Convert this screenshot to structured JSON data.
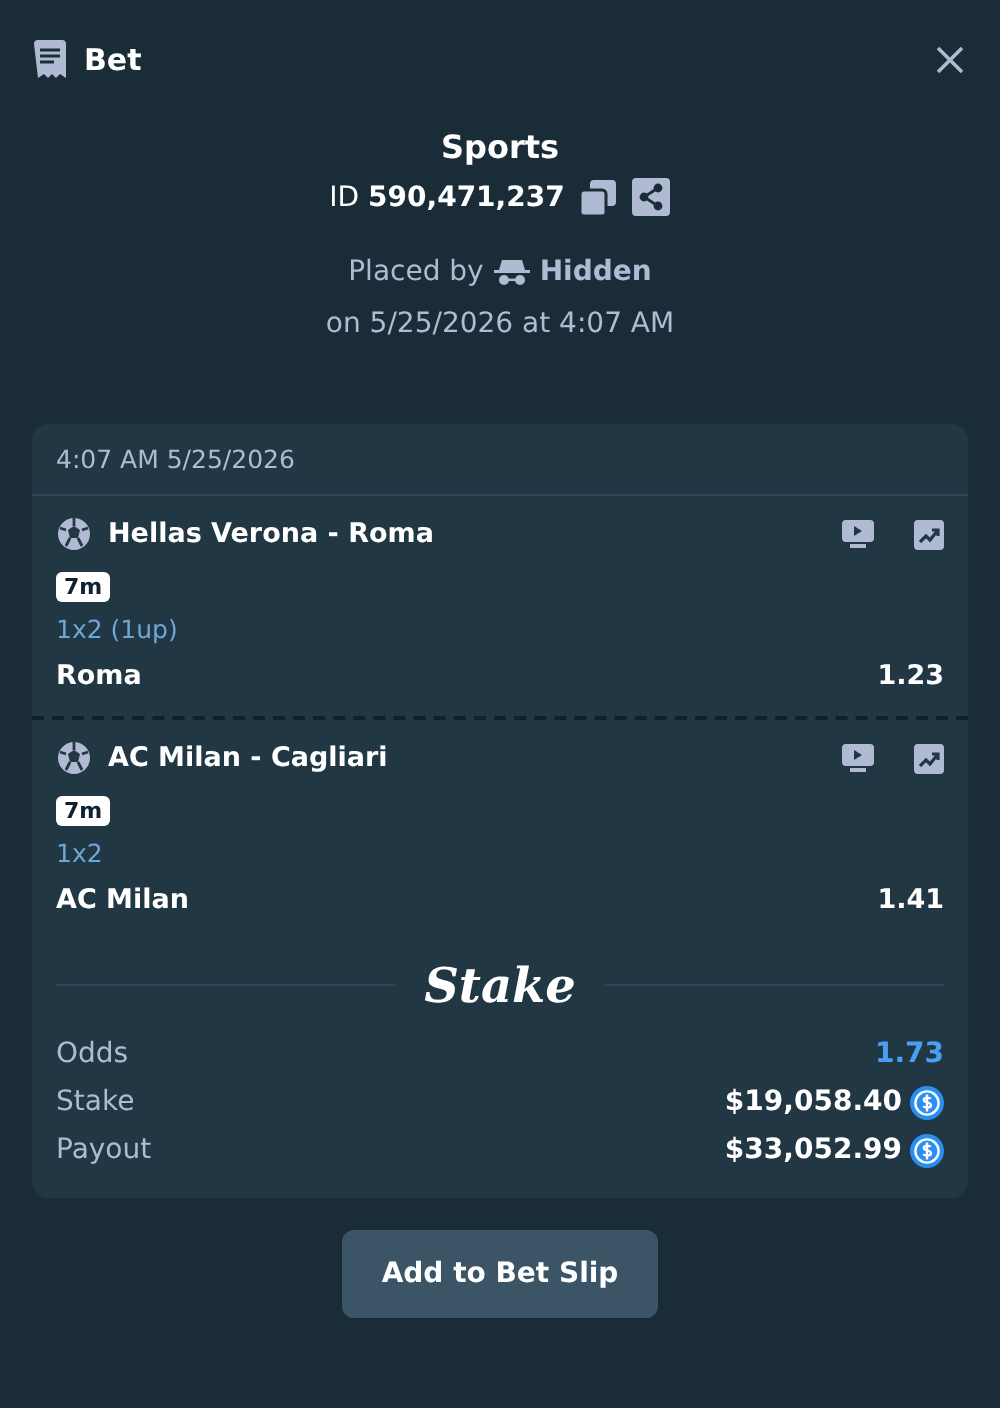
{
  "header": {
    "title": "Bet"
  },
  "bet": {
    "category": "Sports",
    "id_label": "ID",
    "id_value": "590,471,237",
    "placed_by_label": "Placed by",
    "placed_by_user": "Hidden",
    "placed_on": "on 5/25/2026 at 4:07 AM"
  },
  "card": {
    "timestamp": "4:07 AM 5/25/2026",
    "legs": [
      {
        "event": "Hellas Verona - Roma",
        "badge": "7m",
        "market": "1x2 (1up)",
        "selection": "Roma",
        "odds": "1.23"
      },
      {
        "event": "AC Milan - Cagliari",
        "badge": "7m",
        "market": "1x2",
        "selection": "AC Milan",
        "odds": "1.41"
      }
    ],
    "logo": "Stake",
    "summary": [
      {
        "kind": "odds",
        "label": "Odds",
        "value": "1.73"
      },
      {
        "kind": "amount",
        "label": "Stake",
        "value": "$19,058.40"
      },
      {
        "kind": "amount",
        "label": "Payout",
        "value": "$33,052.99"
      }
    ]
  },
  "button": "Add to Bet Slip"
}
